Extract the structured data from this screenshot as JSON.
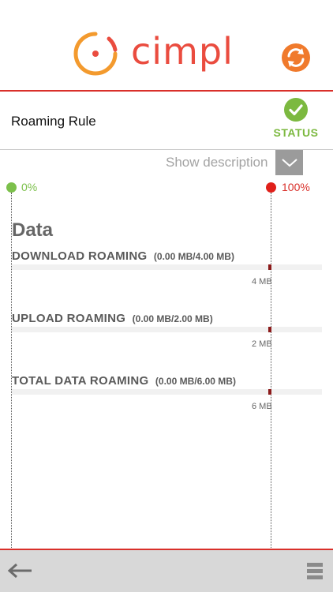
{
  "header": {
    "brand": "cimpl",
    "logo_icon": "cimpl-logo-icon",
    "refresh_icon": "refresh-icon",
    "accent_color": "#ea4c3f"
  },
  "rule": {
    "title": "Roaming Rule",
    "status_label": "STATUS",
    "status_icon": "check-circle-icon",
    "status_color": "#7cb940"
  },
  "description_toggle": {
    "label": "Show description",
    "icon": "chevron-down-icon"
  },
  "scale": {
    "min_label": "0%",
    "max_label": "100%",
    "min_color": "#7cc04b",
    "max_color": "#e0201a"
  },
  "section": {
    "title": "Data"
  },
  "metrics": [
    {
      "name": "DOWNLOAD ROAMING",
      "values": "(0.00 MB/4.00 MB)",
      "used": 0.0,
      "limit": 4.0,
      "cap_label": "4 MB"
    },
    {
      "name": "UPLOAD ROAMING",
      "values": "(0.00 MB/2.00 MB)",
      "used": 0.0,
      "limit": 2.0,
      "cap_label": "2 MB"
    },
    {
      "name": "TOTAL DATA ROAMING",
      "values": "(0.00 MB/6.00 MB)",
      "used": 0.0,
      "limit": 6.0,
      "cap_label": "6 MB"
    }
  ],
  "footer": {
    "back_icon": "back-arrow-icon",
    "menu_icon": "menu-icon"
  }
}
